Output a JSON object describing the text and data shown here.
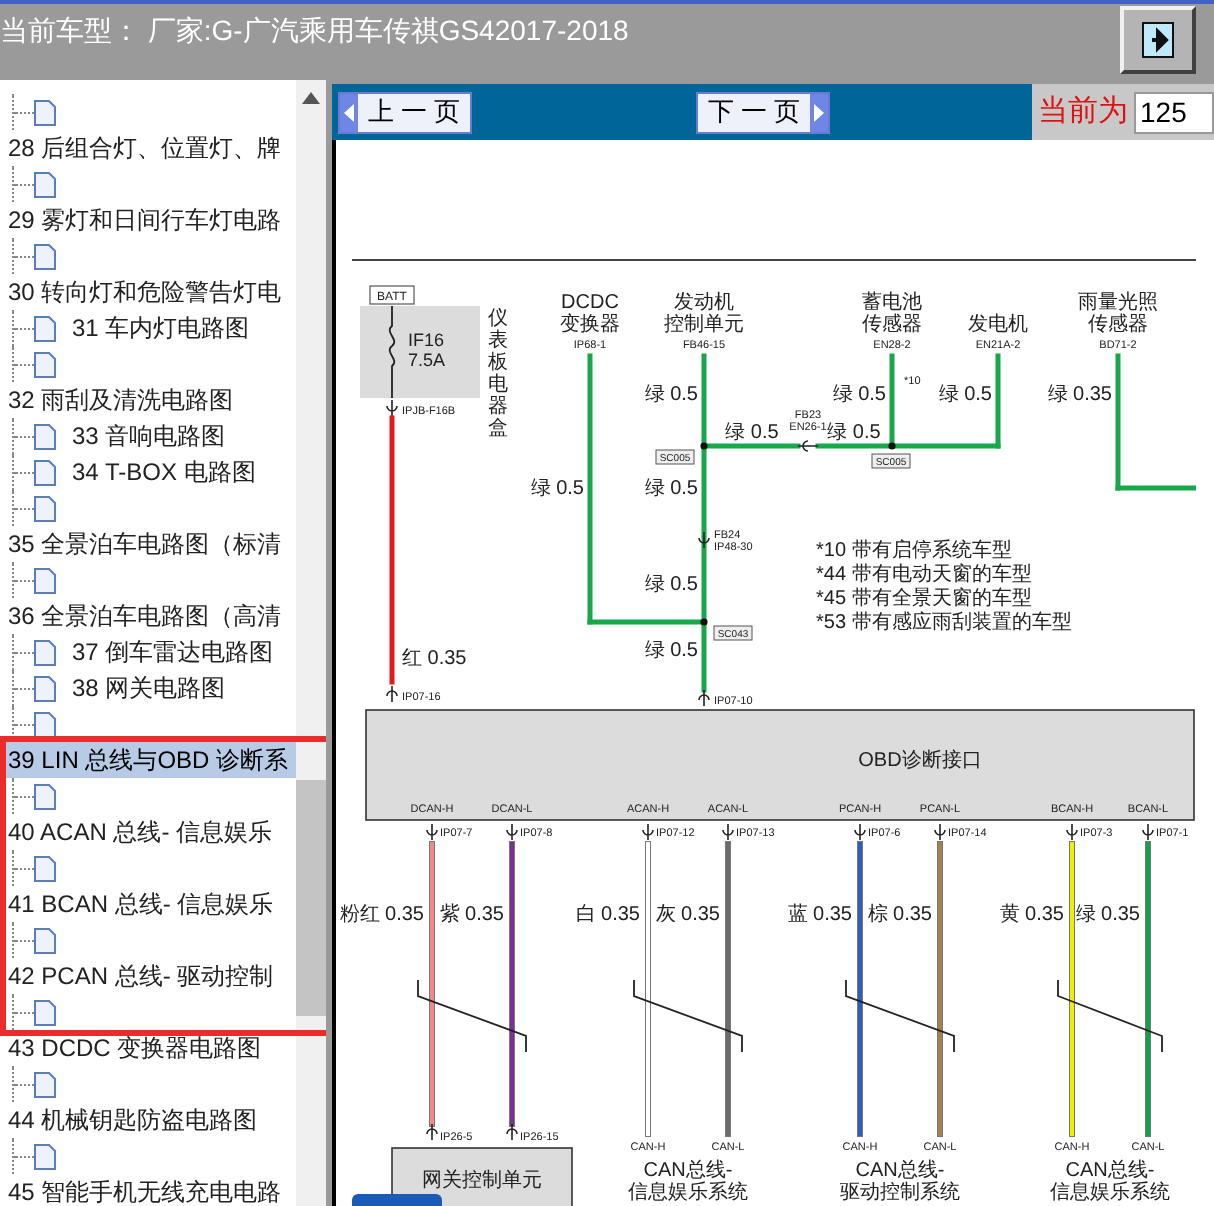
{
  "title_bar": {
    "text": "当前车型： 厂家:G-广汽乘用车传祺GS42017-2018"
  },
  "tree": {
    "highlight_frame": true,
    "rows": [
      {
        "kind": "page",
        "selected": false
      },
      {
        "kind": "folder",
        "label": "28 后组合灯、位置灯、牌",
        "selected": false
      },
      {
        "kind": "page",
        "selected": false
      },
      {
        "kind": "folder",
        "label": "29 雾灯和日间行车灯电路",
        "selected": false
      },
      {
        "kind": "page",
        "selected": false
      },
      {
        "kind": "folder",
        "label": "30 转向灯和危险警告灯电",
        "selected": false
      },
      {
        "kind": "page",
        "label": "31 车内灯电路图",
        "selected": false
      },
      {
        "kind": "page",
        "selected": false
      },
      {
        "kind": "folder",
        "label": "32 雨刮及清洗电路图",
        "selected": false
      },
      {
        "kind": "page",
        "label": "33 音响电路图",
        "selected": false
      },
      {
        "kind": "page",
        "label": "34 T-BOX 电路图",
        "selected": false
      },
      {
        "kind": "page",
        "selected": false
      },
      {
        "kind": "folder",
        "label": "35 全景泊车电路图（标清",
        "selected": false
      },
      {
        "kind": "page",
        "selected": false
      },
      {
        "kind": "folder",
        "label": "36 全景泊车电路图（高清",
        "selected": false
      },
      {
        "kind": "page",
        "label": "37 倒车雷达电路图",
        "selected": false
      },
      {
        "kind": "page",
        "label": "38 网关电路图",
        "selected": false
      },
      {
        "kind": "page",
        "selected": false
      },
      {
        "kind": "folder",
        "label": "39 LIN 总线与OBD 诊断系",
        "selected": true
      },
      {
        "kind": "page",
        "selected": false
      },
      {
        "kind": "folder",
        "label": "40 ACAN 总线- 信息娱乐",
        "selected": false
      },
      {
        "kind": "page",
        "selected": false
      },
      {
        "kind": "folder",
        "label": "41 BCAN 总线- 信息娱乐",
        "selected": false
      },
      {
        "kind": "page",
        "selected": false
      },
      {
        "kind": "folder",
        "label": "42 PCAN 总线- 驱动控制",
        "selected": false
      },
      {
        "kind": "page",
        "selected": false
      },
      {
        "kind": "folder",
        "label": "43 DCDC 变换器电路图",
        "selected": false
      },
      {
        "kind": "page",
        "selected": false
      },
      {
        "kind": "folder",
        "label": "44 机械钥匙防盗电路图",
        "selected": false
      },
      {
        "kind": "page",
        "selected": false
      },
      {
        "kind": "folder",
        "label": "45 智能手机无线充电电路",
        "selected": false
      }
    ]
  },
  "toolbar": {
    "prev": "上 一 页",
    "next": "下 一 页",
    "page_label": "当前为",
    "page_value": "125"
  },
  "diagram": {
    "fuse_box": {
      "source": "BATT",
      "fuse": "IF16",
      "rating": "7.5A",
      "name": "仪表板电器盒",
      "top_pin": "IPJB-F16B",
      "wire_label": "红 0.35",
      "bottom_pin": "IP07-16"
    },
    "sources": [
      {
        "lines": [
          "DCDC",
          "变换器"
        ],
        "pin": "IP68-1"
      },
      {
        "lines": [
          "发动机",
          "控制单元"
        ],
        "pin": "FB46-15"
      },
      {
        "lines": [
          "蓄电池",
          "传感器"
        ],
        "pin": "EN28-2",
        "note": "*10"
      },
      {
        "lines": [
          "发电机"
        ],
        "pin": "EN21A-2"
      },
      {
        "lines": [
          "雨量光照",
          "传感器"
        ],
        "pin": "BD71-2"
      }
    ],
    "segment_labels": [
      "绿 0.5",
      "绿 0.5",
      "绿 0.5",
      "绿 0.35",
      "绿 0.5",
      "绿 0.5",
      "绿 0.5",
      "绿 0.5",
      "绿 0.5",
      "绿 0.5"
    ],
    "splices": [
      "SC005",
      "SC005",
      "SC043"
    ],
    "inline_connectors": [
      {
        "lines": [
          "FB23",
          "EN26-1"
        ]
      },
      {
        "lines": [
          "FB24",
          "IP48-30"
        ]
      }
    ],
    "ecu_bottom_pin": "IP07-10",
    "notes": [
      "*10 带有启停系统车型",
      "*44 带有电动天窗的车型",
      "*45 带有全景天窗的车型",
      "*53 带有感应雨刮装置的车型"
    ],
    "obd": {
      "name": "OBD诊断接口",
      "pins": [
        {
          "name": "DCAN-H",
          "pin": "IP07-7",
          "wire": "粉红 0.35",
          "color": "#f08a8a",
          "end": "IP26-5"
        },
        {
          "name": "DCAN-L",
          "pin": "IP07-8",
          "wire": "紫 0.35",
          "color": "#7b2f8f",
          "end": "IP26-15"
        },
        {
          "name": "ACAN-H",
          "pin": "IP07-12",
          "wire": "白 0.35",
          "color": "#ffffff",
          "end": "CAN-H"
        },
        {
          "name": "ACAN-L",
          "pin": "IP07-13",
          "wire": "灰 0.35",
          "color": "#6b6b6b",
          "end": "CAN-L"
        },
        {
          "name": "PCAN-H",
          "pin": "IP07-6",
          "wire": "蓝 0.35",
          "color": "#2b5fb4",
          "end": "CAN-H"
        },
        {
          "name": "PCAN-L",
          "pin": "IP07-14",
          "wire": "棕 0.35",
          "color": "#a4824e",
          "end": "CAN-L"
        },
        {
          "name": "BCAN-H",
          "pin": "IP07-3",
          "wire": "黄 0.35",
          "color": "#f2ee00",
          "end": "CAN-H"
        },
        {
          "name": "BCAN-L",
          "pin": "IP07-1",
          "wire": "绿 0.35",
          "color": "#13a04a",
          "end": "CAN-L"
        }
      ]
    },
    "gateway": {
      "name": "网关控制单元"
    },
    "buses": [
      {
        "lines": [
          "CAN总线-",
          "信息娱乐系统"
        ]
      },
      {
        "lines": [
          "CAN总线-",
          "驱动控制系统"
        ]
      },
      {
        "lines": [
          "CAN总线-",
          "信息娱乐系统"
        ]
      }
    ]
  }
}
